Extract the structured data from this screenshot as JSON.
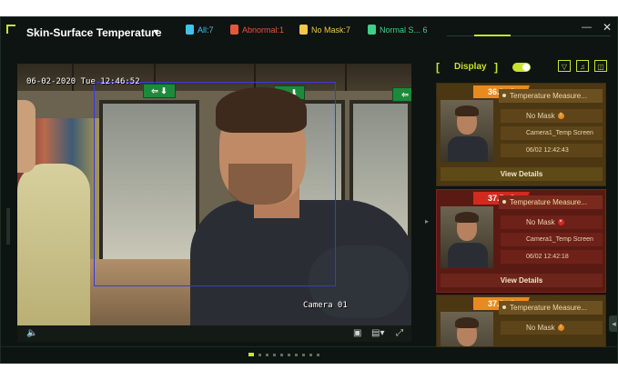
{
  "app": {
    "title": "Skin-Surface Temperature",
    "stats": [
      {
        "label": "All:7"
      },
      {
        "label": "Abnormal:1"
      },
      {
        "label": "No Mask:7"
      },
      {
        "label": "Normal S... 6"
      }
    ],
    "window": {
      "minimize": "—",
      "close": "✕"
    }
  },
  "video": {
    "timestamp": "06-02-2020 Tue 12:46:52",
    "camera_label": "Camera 01",
    "controls": {
      "volume_icon": "speaker-icon",
      "snapshot_icon": "snapshot-icon",
      "layout_icon": "layout-icon",
      "fullscreen_icon": "fullscreen-icon"
    }
  },
  "panel": {
    "display_label": "Display",
    "display_on": true,
    "cards": [
      {
        "temperature": "36.9 °C",
        "status": "warn",
        "title": "Temperature Measure...",
        "mask": "No Mask",
        "camera": "Camera1_Temp Screen",
        "time": "06/02 12:42:43",
        "details": "View Details"
      },
      {
        "temperature": "37.5 °C",
        "status": "abnormal",
        "title": "Temperature Measure...",
        "mask": "No Mask",
        "camera": "Camera1_Temp Screen",
        "time": "06/02 12:42:18",
        "details": "View Details"
      },
      {
        "temperature": "37.3 °C",
        "status": "warn",
        "title": "Temperature Measure...",
        "mask": "No Mask",
        "camera": "",
        "time": "",
        "details": ""
      }
    ]
  },
  "pager": {
    "pages": 10,
    "active": 1
  },
  "colors": {
    "accent": "#c8e32a",
    "abnormal": "#d22a1f",
    "warning": "#e98a1f",
    "normal": "#3fd087",
    "all": "#3fc3e8"
  }
}
